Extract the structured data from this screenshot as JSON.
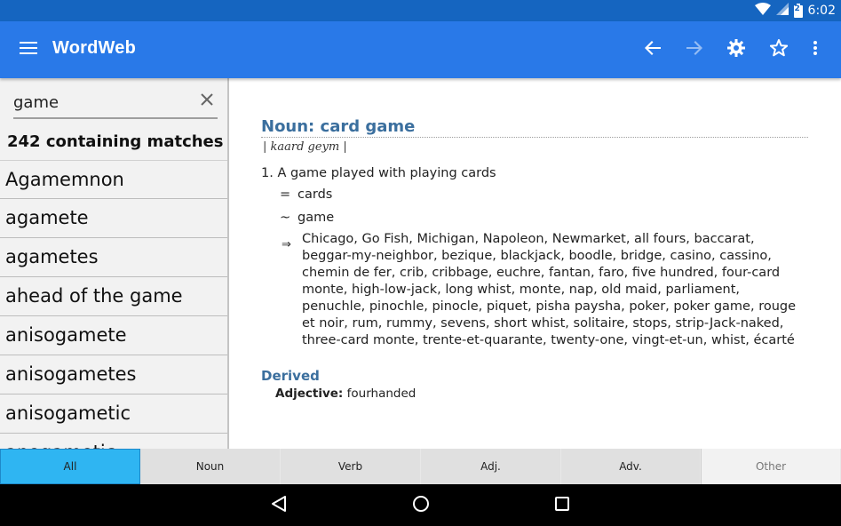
{
  "status_bar": {
    "time": "6:02",
    "icons": [
      "wifi-icon",
      "signal-icon",
      "battery-icon"
    ],
    "battery_level_text": "2"
  },
  "app_bar": {
    "title": "WordWeb",
    "icons": [
      "menu-icon",
      "back-arrow-icon",
      "forward-arrow-icon",
      "settings-gear-icon",
      "star-icon",
      "overflow-menu-icon"
    ]
  },
  "search": {
    "value": "game",
    "clear_icon": "close-icon"
  },
  "results": {
    "count_label": "242 containing matches",
    "items": [
      "Agamemnon",
      "agamete",
      "agametes",
      "ahead of the game",
      "anisogamete",
      "anisogametes",
      "anisogametic",
      "anogametic"
    ]
  },
  "entry": {
    "heading": "Noun: card game",
    "pronunciation": "| kaard geym |",
    "definition": "1.  A game played with playing cards",
    "synonym_symbol": "=",
    "synonym": "cards",
    "hypernym_symbol": "~",
    "hypernym": "game",
    "types_symbol": "⇒",
    "types": "Chicago, Go Fish, Michigan, Napoleon, Newmarket, all fours, baccarat, beggar-my-neighbor, bezique, blackjack, boodle, bridge, casino, cassino, chemin de fer, crib, cribbage, euchre, fantan, faro, five hundred, four-card monte, high-low-jack, long whist, monte, nap, old maid, parliament, penuchle, pinochle, pinocle, piquet, pisha paysha, poker, poker game, rouge et noir, rum, rummy, sevens, short whist, solitaire, stops, strip-Jack-naked, three-card monte, trente-et-quarante, twenty-one, vingt-et-un, whist, écarté",
    "derived_heading": "Derived",
    "derived_label": "Adjective:",
    "derived_value": "fourhanded"
  },
  "tabs": [
    {
      "label": "All",
      "active": true
    },
    {
      "label": "Noun",
      "active": false
    },
    {
      "label": "Verb",
      "active": false
    },
    {
      "label": "Adj.",
      "active": false
    },
    {
      "label": "Adv.",
      "active": false
    },
    {
      "label": "Other",
      "active": false
    }
  ],
  "nav_bar": {
    "icons": [
      "nav-back-icon",
      "nav-home-icon",
      "nav-recents-icon"
    ]
  },
  "colors": {
    "status_bar": "#1565c0",
    "app_bar": "#2979e8",
    "heading_blue": "#3b6f9e",
    "active_tab": "#2fb5f2"
  }
}
